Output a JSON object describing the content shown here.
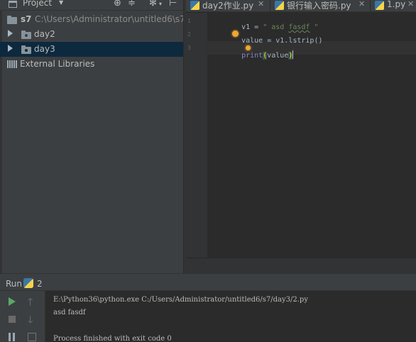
{
  "project_panel": {
    "title": "Project",
    "tree": [
      {
        "label": "s7",
        "path": "C:\\Users\\Administrator\\untitled6\\s7"
      },
      {
        "label": "day2"
      },
      {
        "label": "day3"
      },
      {
        "label": "External Libraries"
      }
    ]
  },
  "editor_tabs": [
    {
      "label": "day2作业.py"
    },
    {
      "label": "银行输入密码.py"
    },
    {
      "label": "1.py"
    }
  ],
  "editor": {
    "line_numbers": [
      "1",
      "2",
      "3"
    ],
    "lines": [
      {
        "var": "v1",
        "op": " = ",
        "str_open": "\" asd ",
        "str_wavy": "fasdf",
        "str_close": " \""
      },
      {
        "var": "value",
        "op": " = ",
        "rest": "v1.lstrip()"
      },
      {
        "builtin": "print",
        "paren_open": "(",
        "arg": "value",
        "paren_close": ")"
      }
    ]
  },
  "run_panel": {
    "title": "Run",
    "config_name": "2",
    "output": [
      "E:\\Python36\\python.exe C:/Users/Administrator/untitled6/s7/day3/2.py",
      "asd fasdf",
      "",
      "Process finished with exit code 0"
    ]
  },
  "colors": {
    "background": "#2b2b2b",
    "panel": "#3c3f41",
    "selection": "#0d293e",
    "string": "#6a8759",
    "builtin": "#8888c6",
    "run_green": "#59a869"
  }
}
